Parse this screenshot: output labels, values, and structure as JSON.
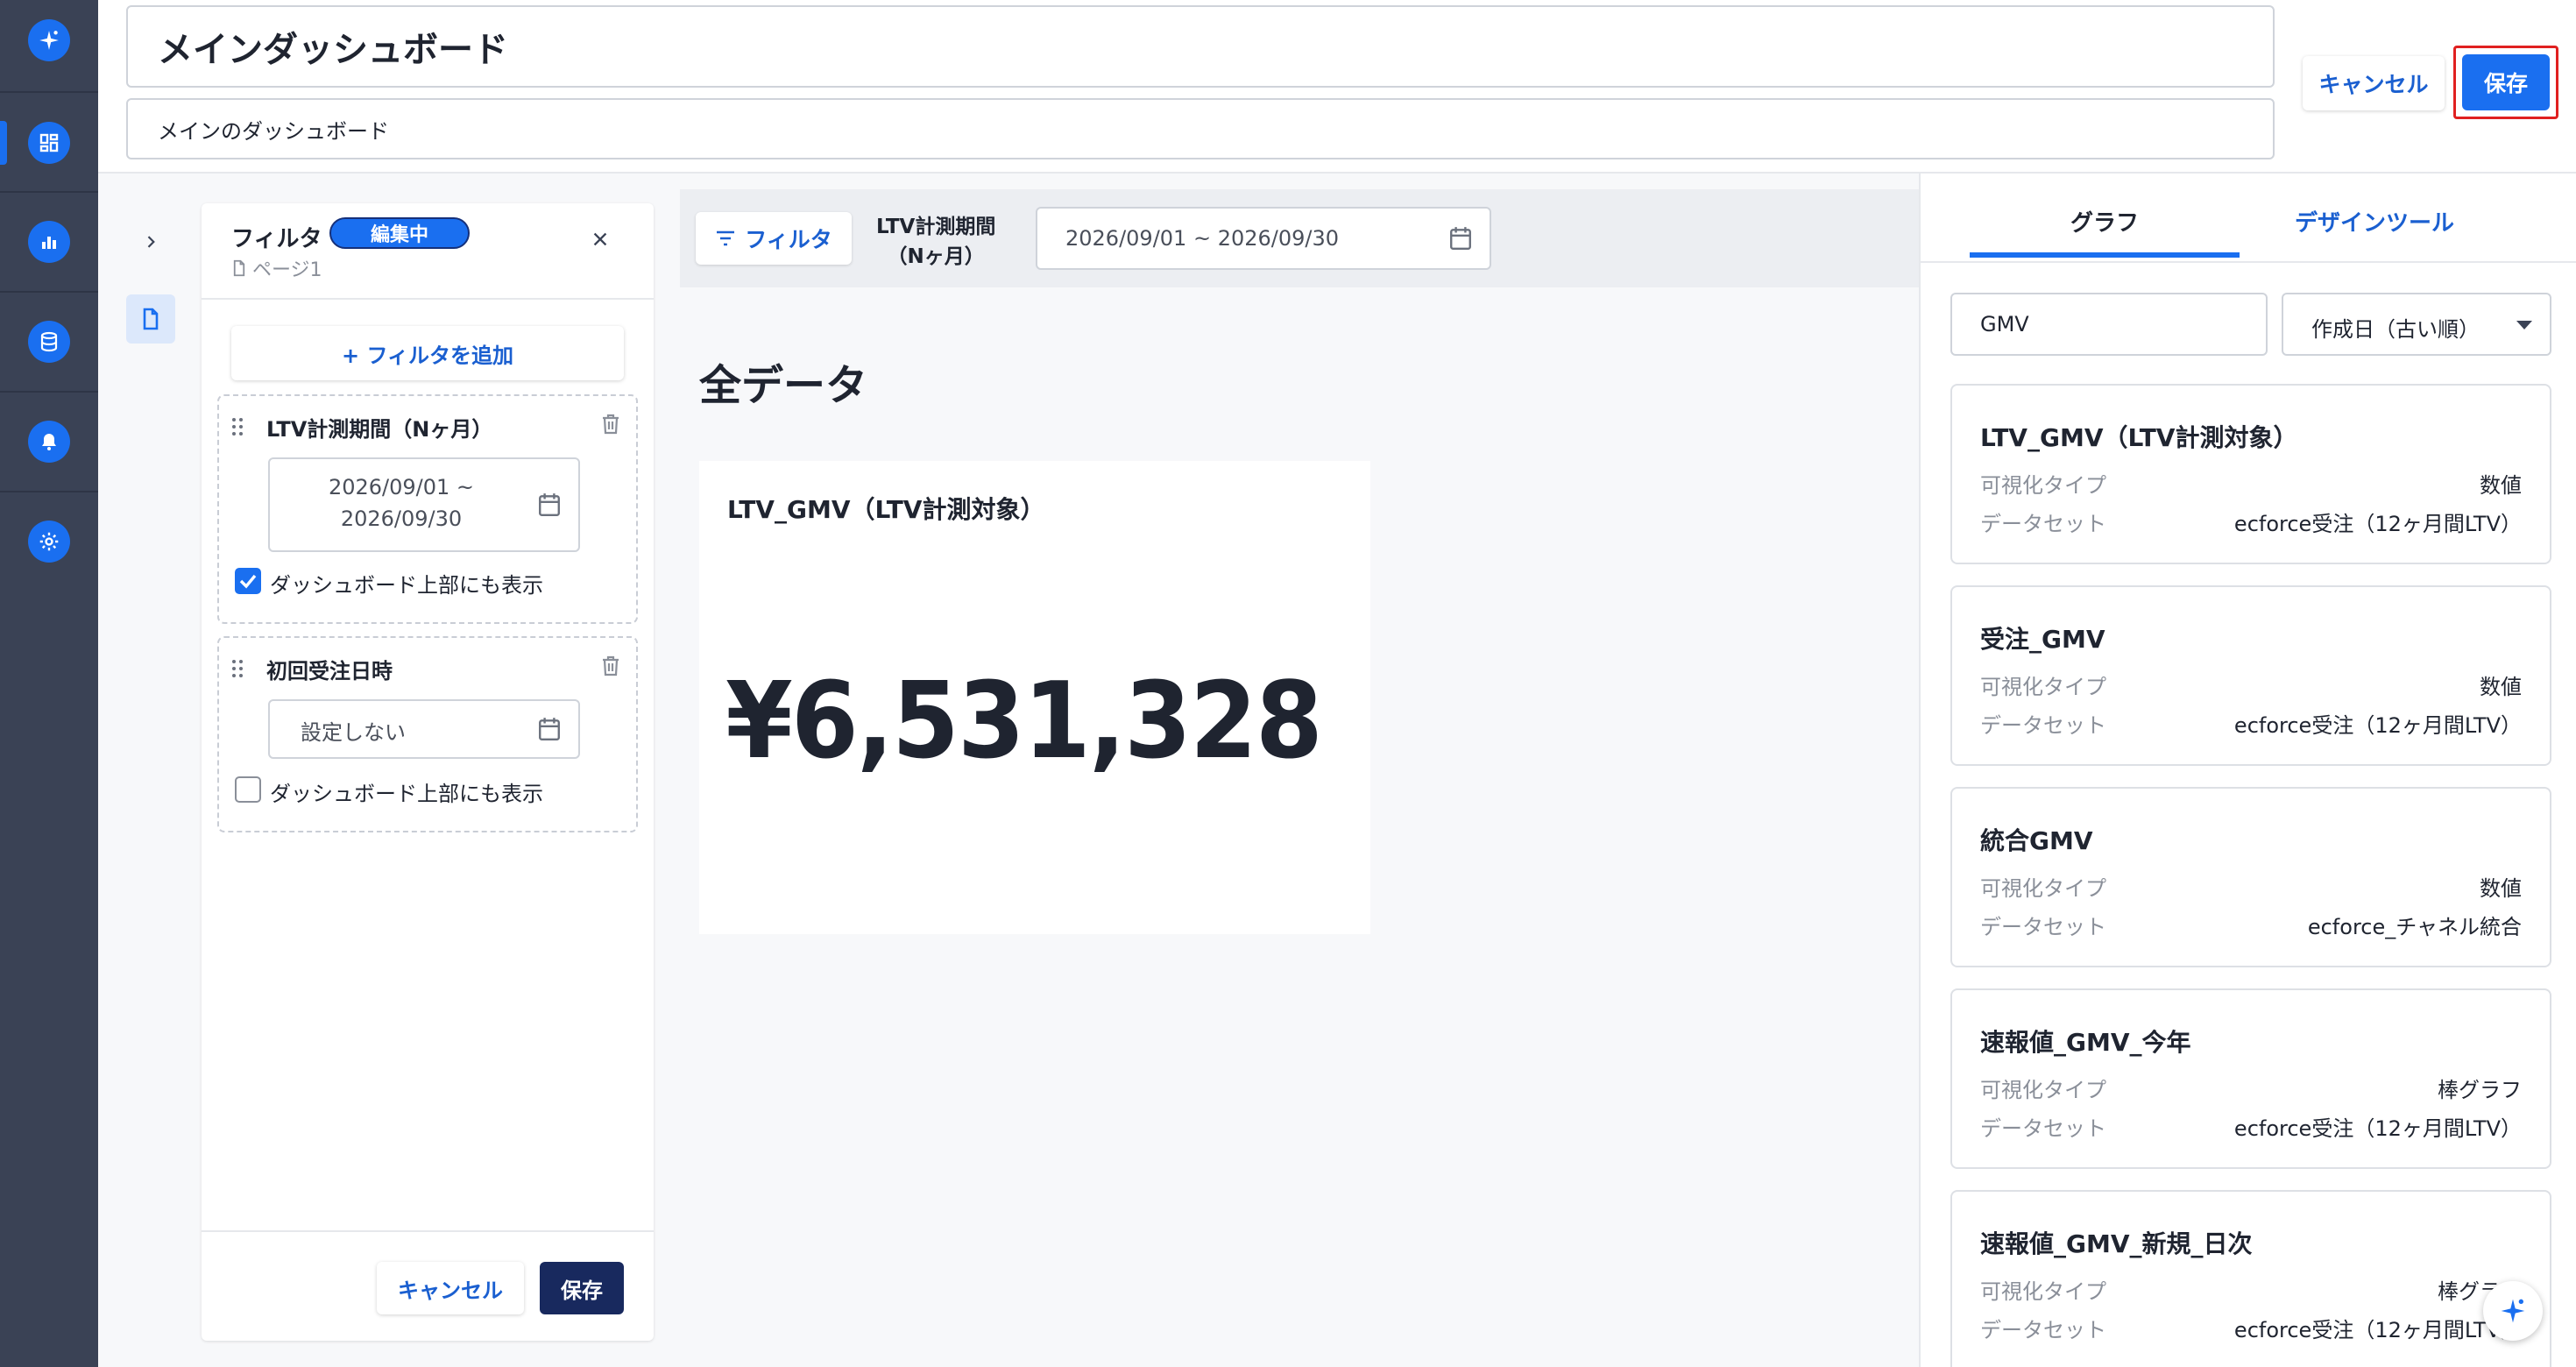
{
  "header": {
    "title": "メインダッシュボード",
    "description": "メインのダッシュボード",
    "cancel_label": "キャンセル",
    "save_label": "保存"
  },
  "filter_panel": {
    "title": "フィルタ",
    "badge": "編集中",
    "page_label": "ページ1",
    "add_filter_label": "+ フィルタを追加",
    "filters": [
      {
        "label": "LTV計測期間（Nヶ月）",
        "value_line1": "2026/09/01 ~",
        "value_line2": "2026/09/30",
        "show_on_top_label": "ダッシュボード上部にも表示",
        "checked": true
      },
      {
        "label": "初回受注日時",
        "value_line1": "設定しない",
        "show_on_top_label": "ダッシュボード上部にも表示",
        "checked": false
      }
    ],
    "cancel_label": "キャンセル",
    "save_label": "保存"
  },
  "canvas": {
    "filter_button_label": "フィルタ",
    "ltv_label_line1": "LTV計測期間",
    "ltv_label_line2": "（Nヶ月）",
    "date_range": "2026/09/01 ~ 2026/09/30",
    "section_title": "全データ",
    "widget": {
      "title": "LTV_GMV（LTV計測対象）",
      "value": "¥6,531,328"
    }
  },
  "right_panel": {
    "tabs": [
      {
        "label": "グラフ",
        "active": true
      },
      {
        "label": "デザインツール",
        "active": false
      }
    ],
    "search_value": "GMV",
    "sort_value": "作成日（古い順）",
    "field_labels": {
      "viz_type": "可視化タイプ",
      "dataset": "データセット"
    },
    "graphs": [
      {
        "title": "LTV_GMV（LTV計測対象）",
        "viz_type": "数値",
        "dataset": "ecforce受注（12ヶ月間LTV）"
      },
      {
        "title": "受注_GMV",
        "viz_type": "数値",
        "dataset": "ecforce受注（12ヶ月間LTV）"
      },
      {
        "title": "統合GMV",
        "viz_type": "数値",
        "dataset": "ecforce_チャネル統合"
      },
      {
        "title": "速報値_GMV_今年",
        "viz_type": "棒グラフ",
        "dataset": "ecforce受注（12ヶ月間LTV）"
      },
      {
        "title": "速報値_GMV_新規_日次",
        "viz_type": "棒グラフ",
        "dataset": "ecforce受注（12ヶ月間LTV）"
      }
    ]
  },
  "colors": {
    "accent": "#1a6ff0",
    "rail": "#3a4255",
    "highlight": "#e02020",
    "dark_button": "#18295e"
  }
}
